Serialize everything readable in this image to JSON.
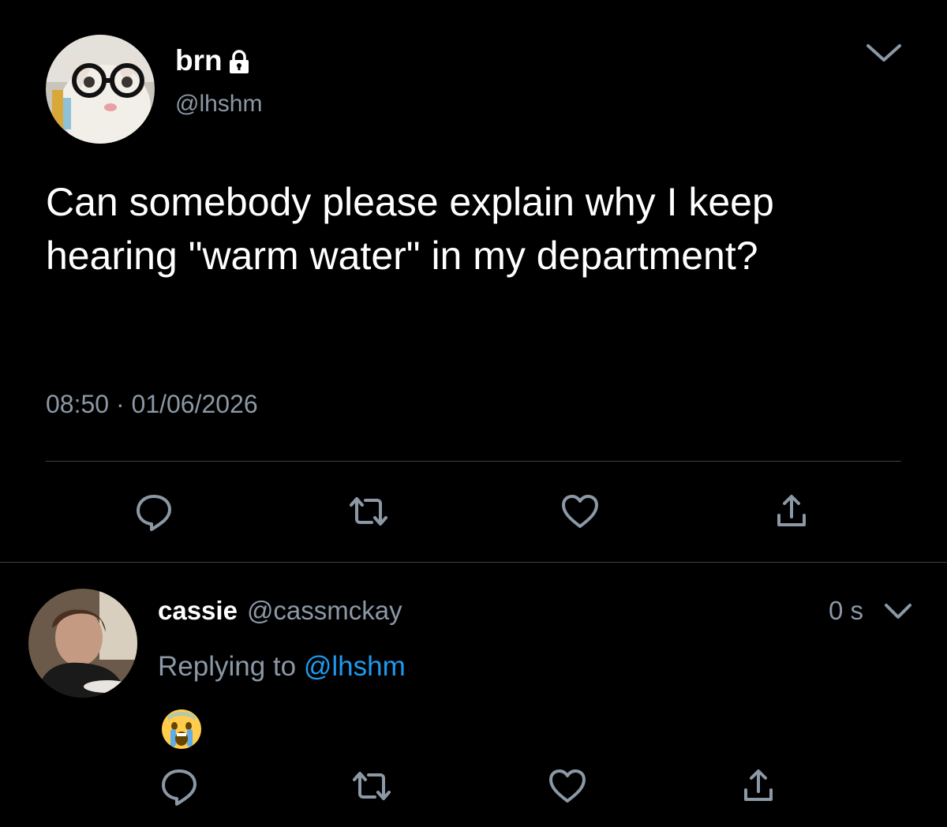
{
  "main_tweet": {
    "display_name": "brn",
    "handle": "@lhshm",
    "text": "Can somebody please explain why I keep hearing \"warm water\" in my department?",
    "time": "08:50",
    "separator": "·",
    "date": "01/06/2026",
    "icons": {
      "lock": "lock-icon",
      "menu": "chevron-down-icon",
      "reply": "reply-icon",
      "retweet": "retweet-icon",
      "like": "heart-icon",
      "share": "share-icon"
    }
  },
  "reply_tweet": {
    "display_name": "cassie",
    "handle": "@cassmckay",
    "time_ago": "0 s",
    "replying_prefix": "Replying to",
    "replying_handle": "@lhshm",
    "emoji": "crying-face-emoji",
    "icons": {
      "menu": "chevron-down-icon",
      "reply": "reply-icon",
      "retweet": "retweet-icon",
      "like": "heart-icon",
      "share": "share-icon"
    }
  },
  "colors": {
    "background": "#000000",
    "text": "#ffffff",
    "secondary_text": "#8b98a5",
    "link": "#1d9bf0",
    "divider": "#38444d"
  }
}
